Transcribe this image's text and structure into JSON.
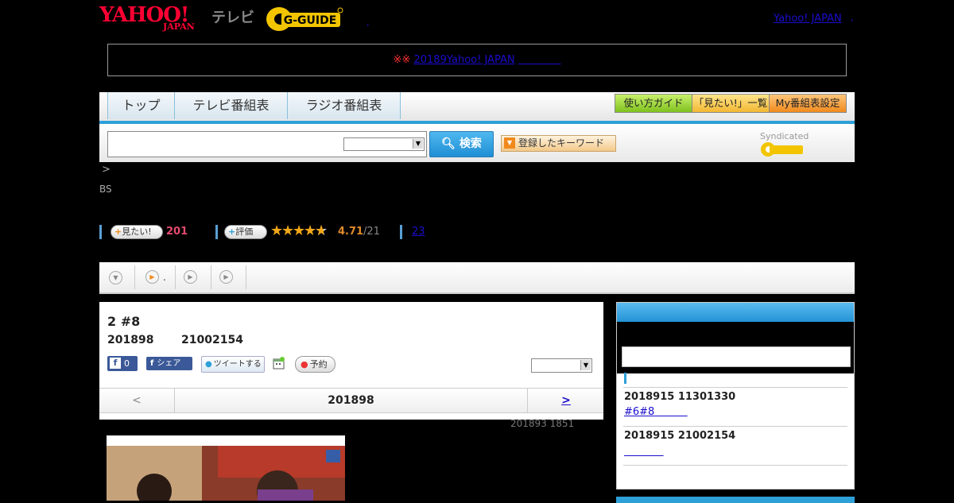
{
  "header": {
    "logo_text": "YAHOO!",
    "logo_sub": "JAPAN",
    "tv_label": "テレビ",
    "gguide_label": "G-GUIDE",
    "separator": ",",
    "yahoo_link": "Yahoo! JAPAN",
    "link_separator": ","
  },
  "notice": {
    "marks": "※※",
    "link_text": "20189Yahoo! JAPAN"
  },
  "nav": {
    "tabs": [
      "トップ",
      "テレビ番組表",
      "ラジオ番組表"
    ],
    "tools": [
      "使い方ガイド",
      "「見たい!」一覧",
      "My番組表設定"
    ]
  },
  "search": {
    "button_label": "検索",
    "keyword_button_label": "登録したキーワード",
    "syndicated_label": "Syndicated"
  },
  "breadcrumb": {
    "arrow": ">",
    "channel": "BS"
  },
  "stats": {
    "want_button_label": "見たい!",
    "want_count": "201",
    "rating_button_label": "評価",
    "rating_value": "4.71",
    "rating_fraction": 0.94,
    "rating_count": "/21",
    "review_count": "23"
  },
  "playbar": {
    "second_label": "."
  },
  "program": {
    "title": "2 #8",
    "date": "201898",
    "time": "21002154",
    "fb_like_count": "0",
    "fb_share_label": "シェア",
    "tweet_label": "ツイートする",
    "reserve_label": "予約"
  },
  "date_nav": {
    "prev": "<",
    "current": "201898",
    "next": ">"
  },
  "updated": "201893  1851",
  "sidebar": {
    "items": [
      {
        "date": "2018915  11301330",
        "link": "#6#8"
      },
      {
        "date": "2018915  21002154",
        "link": ""
      }
    ]
  },
  "colors": {
    "brand_red": "#ff0033",
    "accent_blue": "#2ea0d8",
    "want_pink": "#e54a6f",
    "rating_orange": "#e18a2b"
  }
}
